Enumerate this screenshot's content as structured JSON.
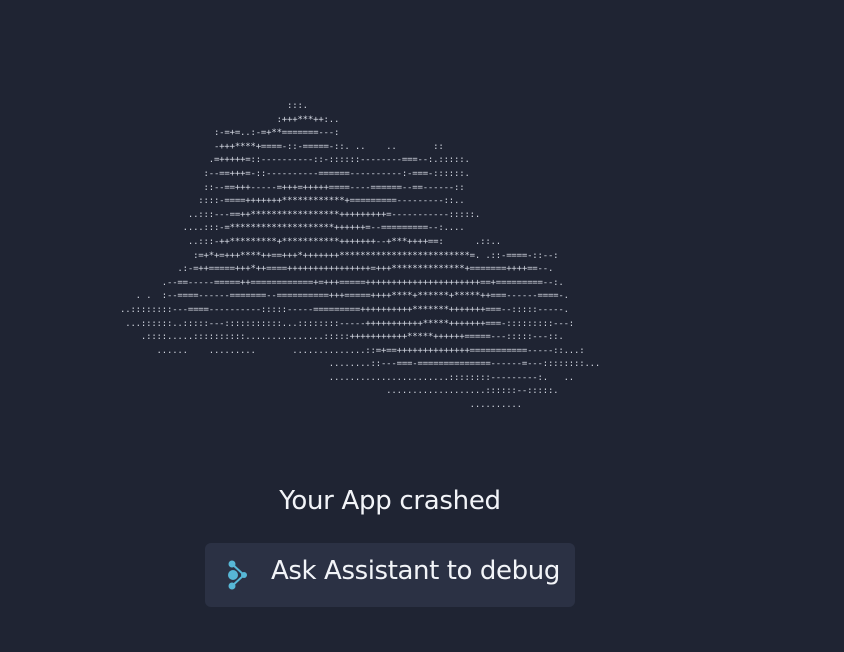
{
  "crash": {
    "ascii_art": "                                                       :::.\n                                                     :+++***++:..\n                                         :-=+=..:-=+**=======---:\n                                         -+++****+====-::-=====-::. ..    ..       ::\n                                        .=+++++=::----------::-::::::--------===--:.:::::.\n                                       :--==+++=-::----------======----------:-===-::::::.\n                                       ::--==+++-----=+++=+++++====----======--==------::\n                                      ::::-====+++++++************+=========---------::..\n                                    ..:::---==++*****************+++++++++=-----------:::::.\n                                   ....:::-=********************++++++=--=========--:....\n                                    ..:::-++*********+***********+++++++--+***++++==:      .::..\n                                     :=+*+=+++****++==+++*+++++++*************************=. .::-====-::--:\n                                  .:-=++=====+++*++====++++++++++++++++=+++**************+=======++++==--.\n                               .--==-----=====++============+=+++=====++++++++++++++++++++++==+=========--:.\n                          . .  :--====------=======--==========+++=====++++****+******+*****++===------====-.\n                       ..::::::::---====----------:::::-----=========++++++++++*******+++++++===--:::::-----.\n                        ...::::::..:::::---:::::::::::...::::::::-----+++++++++++*****+++++++===-:::::::::---:\n                           .::::.....::::::::::...............:::::+++++++++++*****++++++=====---:::::---::.\n                              ......    .........       ..............::=+==++++++++++++++===========-----::...:\n                                                               ........::---===-==============------=---::::::::...\n                                                               .......................::::::::---------:.   ..\n                                                                          ...................::::::--:::::.\n                                                                                          ..........",
    "title": "Your App crashed"
  },
  "actions": {
    "debug_label": "Ask Assistant to debug"
  },
  "colors": {
    "background": "#1f2433",
    "button_background": "#2b3144",
    "text": "#f2f4f8",
    "ascii_art": "#d4d8e2",
    "icon_accent": "#57b7d6"
  },
  "icons": {
    "assistant": "assistant-icon"
  }
}
